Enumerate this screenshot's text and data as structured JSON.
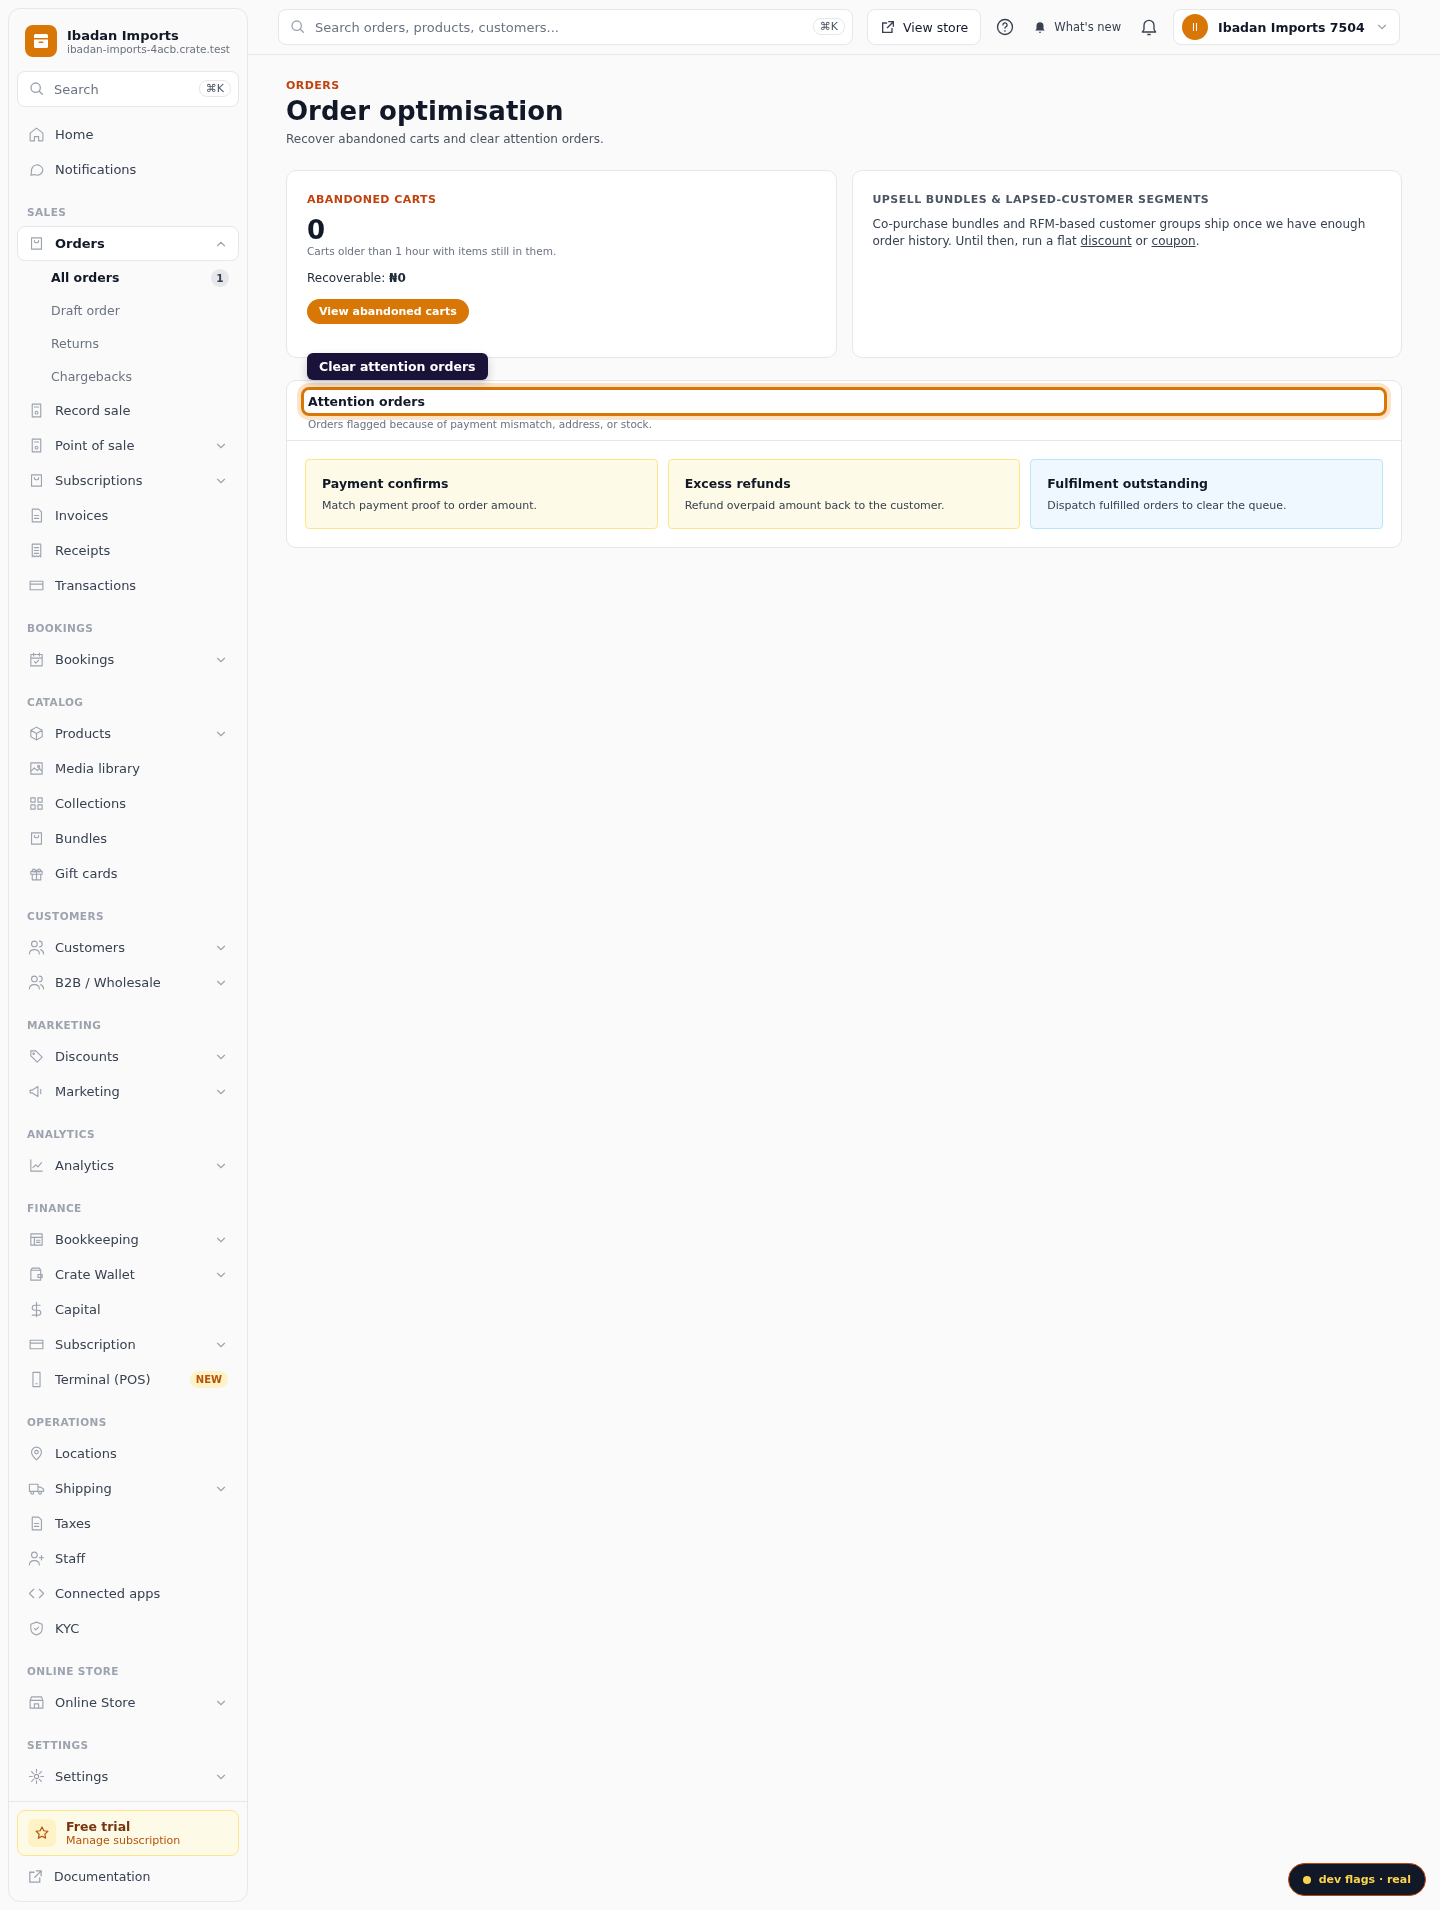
{
  "store": {
    "name": "Ibadan Imports",
    "domain": "ibadan-imports-4acb.crate.test"
  },
  "sidebar": {
    "search": {
      "placeholder": "Search",
      "shortcut": "⌘K"
    },
    "sections": [
      {
        "items": [
          {
            "label": "Home"
          },
          {
            "label": "Notifications"
          }
        ]
      },
      {
        "heading": "SALES",
        "items": [
          {
            "label": "Orders",
            "selected": true,
            "expanded": true,
            "children": [
              {
                "label": "All orders",
                "selected": true,
                "badge": "1"
              },
              {
                "label": "Draft order",
                "selected": false
              },
              {
                "label": "Returns",
                "selected": false
              },
              {
                "label": "Chargebacks",
                "selected": false
              }
            ]
          },
          {
            "label": "Record sale"
          },
          {
            "label": "Point of sale",
            "expanded": false
          },
          {
            "label": "Subscriptions",
            "expanded": false
          },
          {
            "label": "Invoices"
          },
          {
            "label": "Receipts"
          },
          {
            "label": "Transactions"
          }
        ]
      },
      {
        "heading": "BOOKINGS",
        "items": [
          {
            "label": "Bookings",
            "expanded": false
          }
        ]
      },
      {
        "heading": "CATALOG",
        "items": [
          {
            "label": "Products",
            "expanded": false
          },
          {
            "label": "Media library"
          },
          {
            "label": "Collections"
          },
          {
            "label": "Bundles"
          },
          {
            "label": "Gift cards"
          }
        ]
      },
      {
        "heading": "CUSTOMERS",
        "items": [
          {
            "label": "Customers",
            "expanded": false
          },
          {
            "label": "B2B / Wholesale",
            "expanded": false
          }
        ]
      },
      {
        "heading": "MARKETING",
        "items": [
          {
            "label": "Discounts",
            "expanded": false
          },
          {
            "label": "Marketing",
            "expanded": false
          }
        ]
      },
      {
        "heading": "ANALYTICS",
        "items": [
          {
            "label": "Analytics",
            "expanded": false
          }
        ]
      },
      {
        "heading": "FINANCE",
        "items": [
          {
            "label": "Bookkeeping",
            "expanded": false
          },
          {
            "label": "Crate Wallet",
            "expanded": false
          },
          {
            "label": "Capital"
          },
          {
            "label": "Subscription",
            "expanded": false
          },
          {
            "label": "Terminal (POS)",
            "badge": "NEW"
          }
        ]
      },
      {
        "heading": "OPERATIONS",
        "items": [
          {
            "label": "Locations"
          },
          {
            "label": "Shipping",
            "expanded": false
          },
          {
            "label": "Taxes"
          },
          {
            "label": "Staff"
          },
          {
            "label": "Connected apps"
          },
          {
            "label": "KYC"
          }
        ]
      },
      {
        "heading": "ONLINE STORE",
        "items": [
          {
            "label": "Online Store",
            "expanded": false
          }
        ]
      },
      {
        "heading": "SETTINGS",
        "items": [
          {
            "label": "Settings",
            "expanded": false
          }
        ]
      }
    ],
    "trial": {
      "title": "Free trial",
      "link": "Manage subscription"
    },
    "footer_link": "Documentation"
  },
  "topbar": {
    "search": {
      "placeholder": "Search orders, products, customers...",
      "shortcut": "⌘K"
    },
    "view_store": "View store",
    "whats_new": "What's new",
    "account": {
      "initials": "II",
      "name": "Ibadan Imports 7504"
    }
  },
  "page": {
    "eyebrow": "ORDERS",
    "title": "Order optimisation",
    "subtitle": "Recover abandoned carts and clear attention orders."
  },
  "abandoned": {
    "heading": "ABANDONED CARTS",
    "count": "0",
    "note": "Carts older than 1 hour with items still in them.",
    "recoverable": "Recoverable: **₦0**",
    "button": "View abandoned carts"
  },
  "upsell": {
    "heading": "UPSELL BUNDLES & LAPSED-CUSTOMER SEGMENTS",
    "text_before": "Co-purchase bundles and RFM-based customer groups ship once we have enough order history. Until then, run a flat",
    "link1": "discount",
    "between": "or",
    "link2": "coupon",
    "after": "."
  },
  "attention": {
    "tooltip": "Clear attention orders",
    "title": "Attention orders",
    "subtitle": "Orders flagged because of payment mismatch, address, or stock.",
    "highlighted": true,
    "tiles": [
      {
        "title": "Payment confirms",
        "text": "Match payment proof to order amount.",
        "color": "#fefae8"
      },
      {
        "title": "Excess refunds",
        "text": "Refund overpaid amount back to the customer.",
        "color": "#fefae8"
      },
      {
        "title": "Fulfilment outstanding",
        "text": "Dispatch fulfilled orders to clear the queue.",
        "color": "#eff7ff"
      }
    ]
  },
  "dev_flags": "dev flags · real"
}
